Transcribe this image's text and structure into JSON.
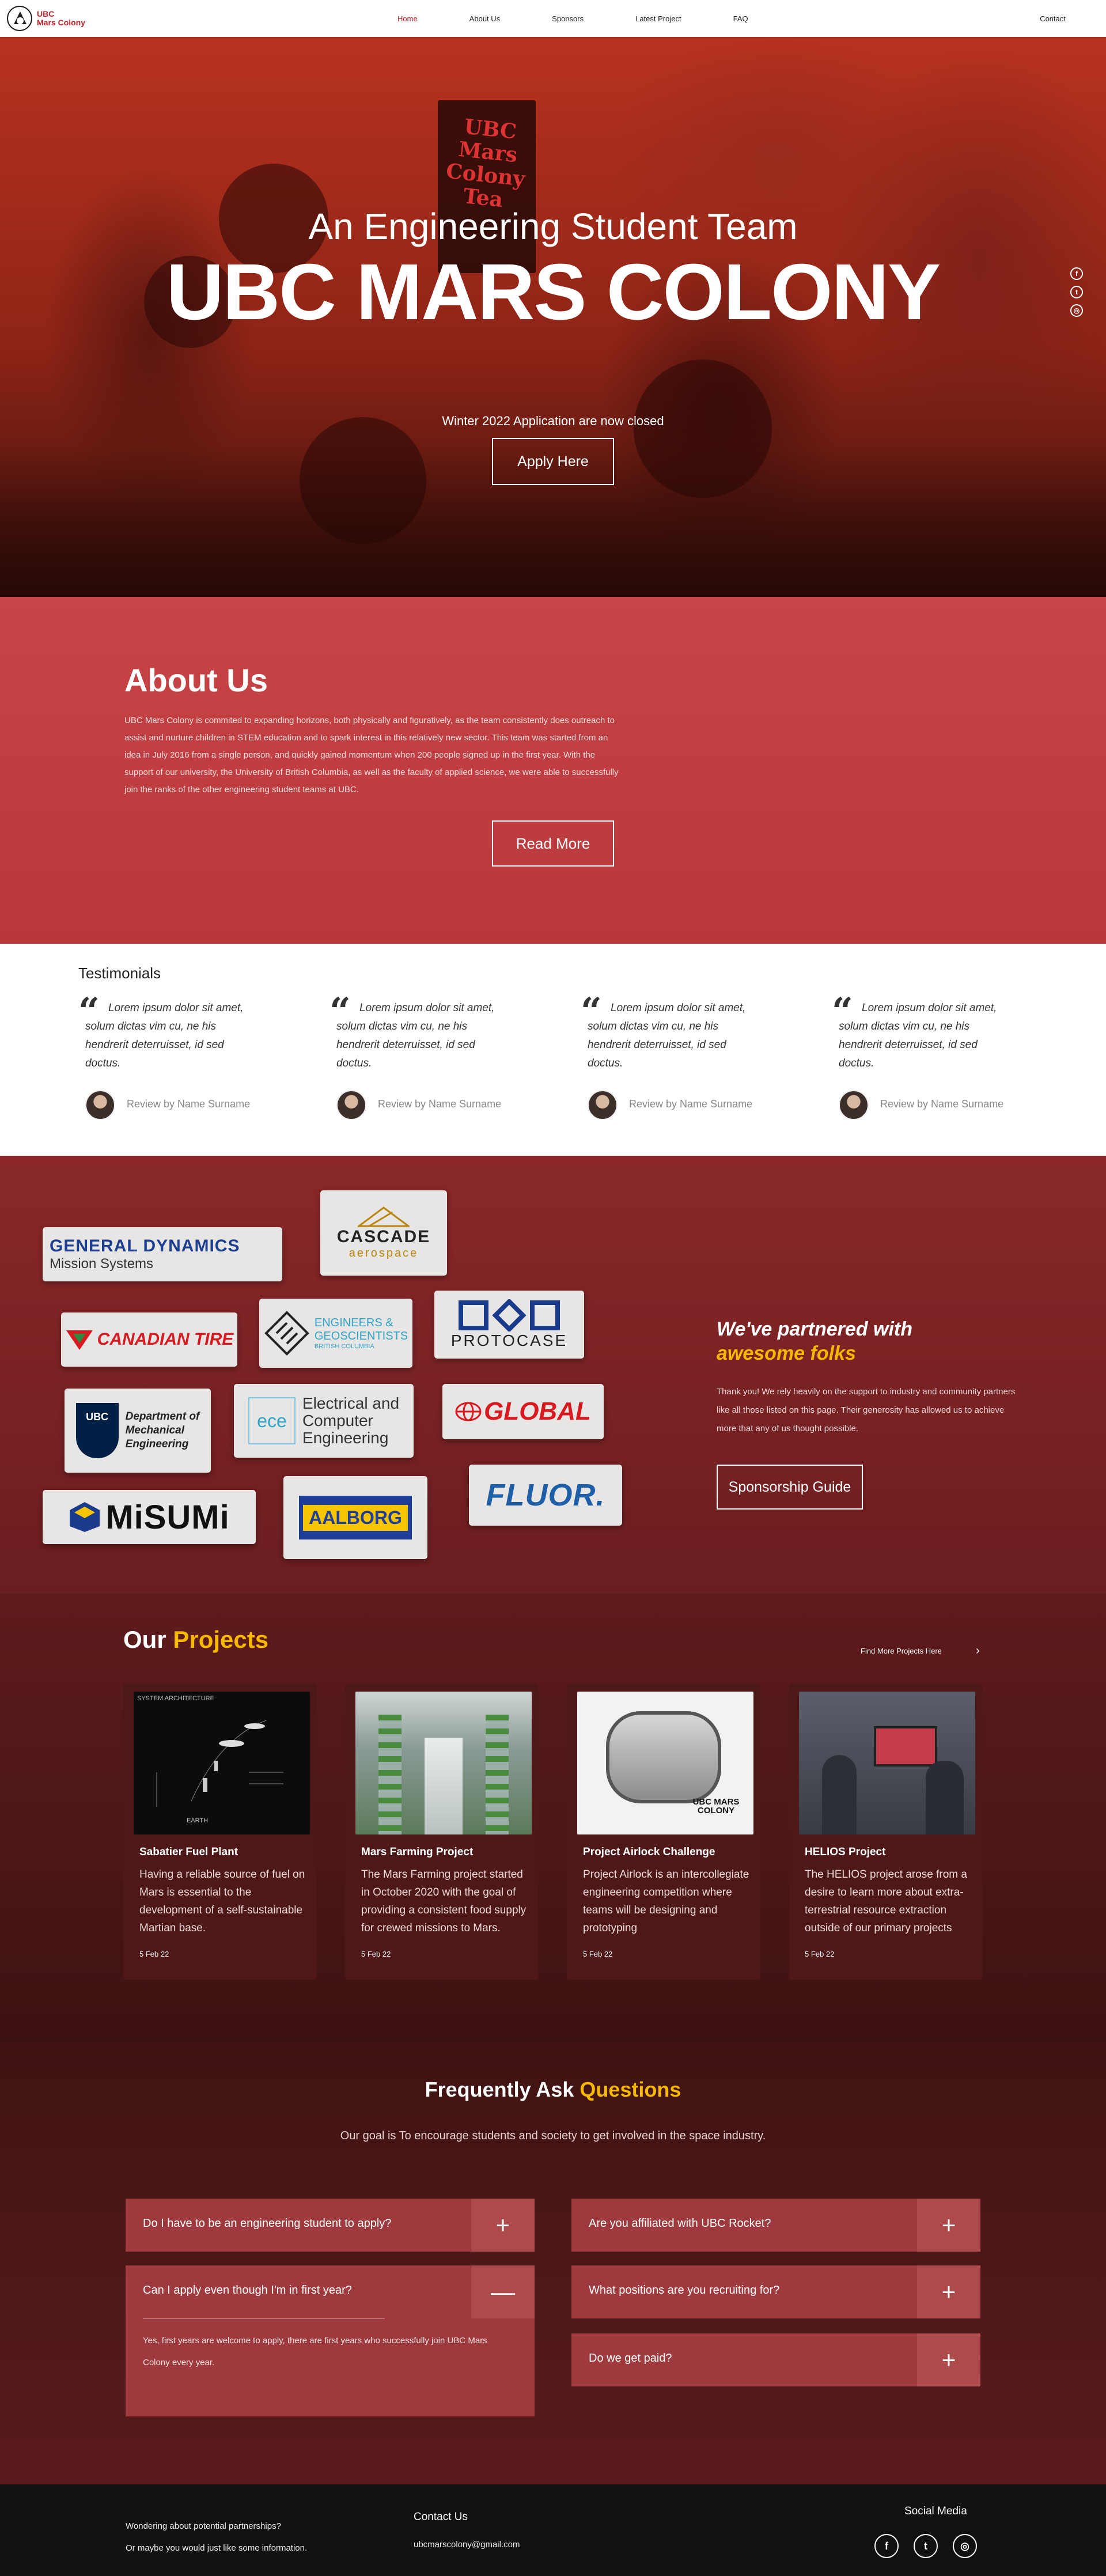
{
  "brand": {
    "line1": "UBC",
    "line2": "Mars Colony",
    "logo_icon": "mars-colony-logo-icon"
  },
  "nav": {
    "items": [
      {
        "label": "Home",
        "active": true
      },
      {
        "label": "About Us"
      },
      {
        "label": "Sponsors"
      },
      {
        "label": "Latest Project"
      },
      {
        "label": "FAQ"
      }
    ],
    "contact": "Contact"
  },
  "hero": {
    "sign_text": "UBC Mars Colony Tea",
    "subtitle": "An Engineering Student Team",
    "title": "UBC MARS COLONY",
    "note": "Winter 2022 Application are now closed",
    "button": "Apply Here",
    "social_icons": [
      "facebook-icon",
      "twitter-icon",
      "instagram-icon"
    ]
  },
  "about": {
    "heading": "About Us",
    "body": "UBC Mars Colony is commited to expanding horizons, both physically and figuratively, as the team consistently does outreach to assist and nurture children in STEM education and to spark interest in this relatively new sector. This team was started from an idea in July 2016 from a single person, and quickly gained momentum when 200 people signed up in the first year. With the support of our university, the University of British Columbia, as well as the faculty of applied science, we were able to successfully join the ranks of the other engineering student teams at UBC.",
    "button": "Read More"
  },
  "testimonials": {
    "heading": "Testimonials",
    "items": [
      {
        "quote": "Lorem ipsum dolor sit amet, solum dictas vim cu, ne his hendrerit deterruisset, id sed doctus.",
        "author": "Review by Name Surname"
      },
      {
        "quote": "Lorem ipsum dolor sit amet, solum dictas vim cu, ne his hendrerit deterruisset, id sed doctus.",
        "author": "Review by Name Surname"
      },
      {
        "quote": "Lorem ipsum dolor sit amet, solum dictas vim cu, ne his hendrerit deterruisset, id sed doctus.",
        "author": "Review by Name Surname"
      },
      {
        "quote": "Lorem ipsum dolor sit amet, solum dictas vim cu, ne his hendrerit deterruisset, id sed doctus.",
        "author": "Review by Name Surname"
      }
    ]
  },
  "sponsors": {
    "logos": {
      "gd_1": "GENERAL DYNAMICS",
      "gd_2": "Mission Systems",
      "cascade_1": "CASCADE",
      "cascade_2": "aerospace",
      "canadian_tire": "CANADIAN TIRE",
      "egbc_1": "ENGINEERS &",
      "egbc_2": "GEOSCIENTISTS",
      "egbc_3": "BRITISH COLUMBIA",
      "protocase": "PROTOCASE",
      "ubc_mech_1": "Department of",
      "ubc_mech_2": "Mechanical",
      "ubc_mech_3": "Engineering",
      "ubc_short": "UBC",
      "ece_mark": "ece",
      "ece_1": "Electrical and",
      "ece_2": "Computer",
      "ece_3": "Engineering",
      "global": "GLOBAL",
      "misumi": "MiSUMi",
      "aalborg": "AALBORG",
      "fluor": "FLUOR."
    },
    "title_line1": "We've partnered with",
    "title_line2": "awesome folks",
    "text": "Thank you! We rely heavily on the support to industry and community partners like all those listed on this page. Their generosity has allowed us to achieve more that any of us thought possible.",
    "button": "Sponsorship Guide"
  },
  "projects": {
    "heading_plain": "Our",
    "heading_accent": "Projects",
    "find_more": "Find More Projects Here",
    "items": [
      {
        "title": "Sabatier Fuel Plant",
        "text": "Having a reliable source of fuel on Mars is essential to the development of a self-sustainable Martian base.",
        "date": "5 Feb 22",
        "image_label": "SYSTEM ARCHITECTURE",
        "image_caption": "EARTH"
      },
      {
        "title": "Mars Farming Project",
        "text": "The Mars Farming project started in October 2020 with the goal of providing a consistent food supply for crewed missions to Mars.",
        "date": "5 Feb 22"
      },
      {
        "title": "Project Airlock Challenge",
        "text": "Project Airlock is an intercollegiate engineering competition where teams will be designing and prototyping",
        "date": "5 Feb 22",
        "image_label": "UBC MARS COLONY"
      },
      {
        "title": "HELIOS Project",
        "text": "The HELIOS project arose from a desire to learn more about extra-terrestrial resource extraction outside of our primary projects",
        "date": "5 Feb 22"
      }
    ]
  },
  "faq": {
    "heading_plain": "Frequently Ask",
    "heading_accent": "Questions",
    "subtitle": "Our goal is To encourage students and society to get involved in the space industry.",
    "items": [
      {
        "q": "Do I have to be an engineering student to apply?",
        "toggle": "+"
      },
      {
        "q": "Can I apply even though I'm in first year?",
        "toggle": "—",
        "answer": "Yes, first years are welcome to apply, there are first years who successfully join UBC Mars Colony every year."
      },
      {
        "q": "Are you affiliated with UBC Rocket?",
        "toggle": "+"
      },
      {
        "q": "What positions are you recruiting for?",
        "toggle": "+"
      },
      {
        "q": "Do we get paid?",
        "toggle": "+"
      }
    ]
  },
  "footer": {
    "line1": "Wondering about potential partnerships?",
    "line2": "Or maybe you would just like some information.",
    "contact_heading": "Contact Us",
    "email": "ubcmarscolony@gmail.com",
    "social_heading": "Social Media",
    "social_icons": [
      "facebook-icon",
      "twitter-icon",
      "instagram-icon"
    ]
  },
  "colors": {
    "brand_red": "#c0242b",
    "accent_yellow": "#f7b800",
    "about_red": "#c84446",
    "dark_maroon": "#3d1212"
  }
}
